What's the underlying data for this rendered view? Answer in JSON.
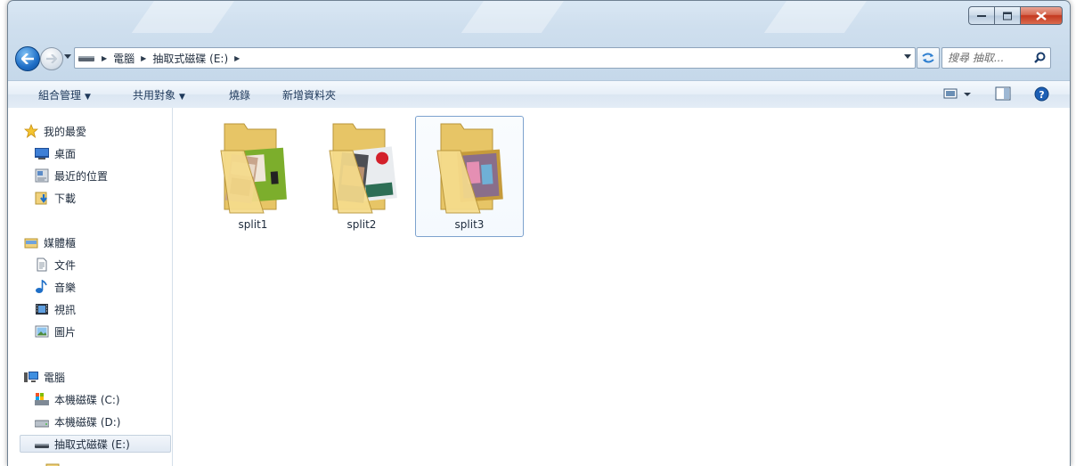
{
  "window": {
    "address": {
      "segments": [
        "電腦",
        "抽取式磁碟 (E:)"
      ]
    },
    "search": {
      "placeholder": "搜尋 抽取..."
    }
  },
  "commandbar": {
    "organize": "組合管理",
    "share": "共用對象",
    "burn": "燒錄",
    "new_folder": "新增資料夾"
  },
  "nav": {
    "favorites": {
      "header": "我的最愛",
      "items": [
        "桌面",
        "最近的位置",
        "下載"
      ]
    },
    "libraries": {
      "header": "媒體櫃",
      "items": [
        "文件",
        "音樂",
        "視訊",
        "圖片"
      ]
    },
    "computer": {
      "header": "電腦",
      "items": [
        "本機磁碟 (C:)",
        "本機磁碟 (D:)",
        "抽取式磁碟 (E:)"
      ]
    }
  },
  "files": [
    {
      "name": "split1"
    },
    {
      "name": "split2"
    },
    {
      "name": "split3"
    }
  ],
  "colors": {
    "accent": "#1f6fc7",
    "folder": "#f1d27d",
    "selection_border": "#7da2ce"
  }
}
